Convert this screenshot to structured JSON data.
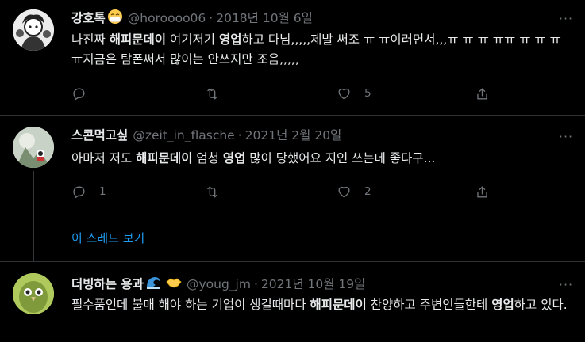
{
  "tweets": [
    {
      "name": "강호톡",
      "handle": "@horoooo06",
      "separator": "·",
      "date": "2018년 10월 6일",
      "text_html": "나진짜 <b>해피문데이</b> 여기저기 <b>영업</b>하고 다님,,,,,제발 써조 ㅠ ㅠ이러면서,,,ㅠ ㅠ ㅠ ㅠㅠ ㅠ ㅠ ㅠ ㅠ지금은 탐폰써서 많이는 안쓰지만 조음,,,,,",
      "actions": {
        "reply": "",
        "retweet": "",
        "like": "5",
        "share": ""
      }
    },
    {
      "name": "스콘먹고싶",
      "handle": "@zeit_in_flasche",
      "separator": "·",
      "date": "2021년 2월 20일",
      "text_html": "아마저 저도 <b>해피문데이</b> 엄청 <b>영업</b> 많이 당했어요 지인 쓰는데 좋다구...",
      "actions": {
        "reply": "1",
        "retweet": "",
        "like": "2",
        "share": ""
      }
    },
    {
      "name": "더빙하는 용과",
      "handle": "@youg_jm",
      "separator": "·",
      "date": "2021년 10월 19일",
      "text_html": "필수품인데 불매 해야 하는 기업이 생길때마다 <b>해피문데이</b> 찬양하고 주변인들한테 <b>영업</b>하고 있다.",
      "actions": {
        "reply": "",
        "retweet": "",
        "like": "",
        "share": ""
      }
    }
  ],
  "show_thread_label": "이 스레드 보기",
  "more_label": "···",
  "colors": {
    "accent": "#1d9bf0",
    "muted": "#71767b",
    "text": "#e7e9ea",
    "divider": "#2f3336"
  }
}
